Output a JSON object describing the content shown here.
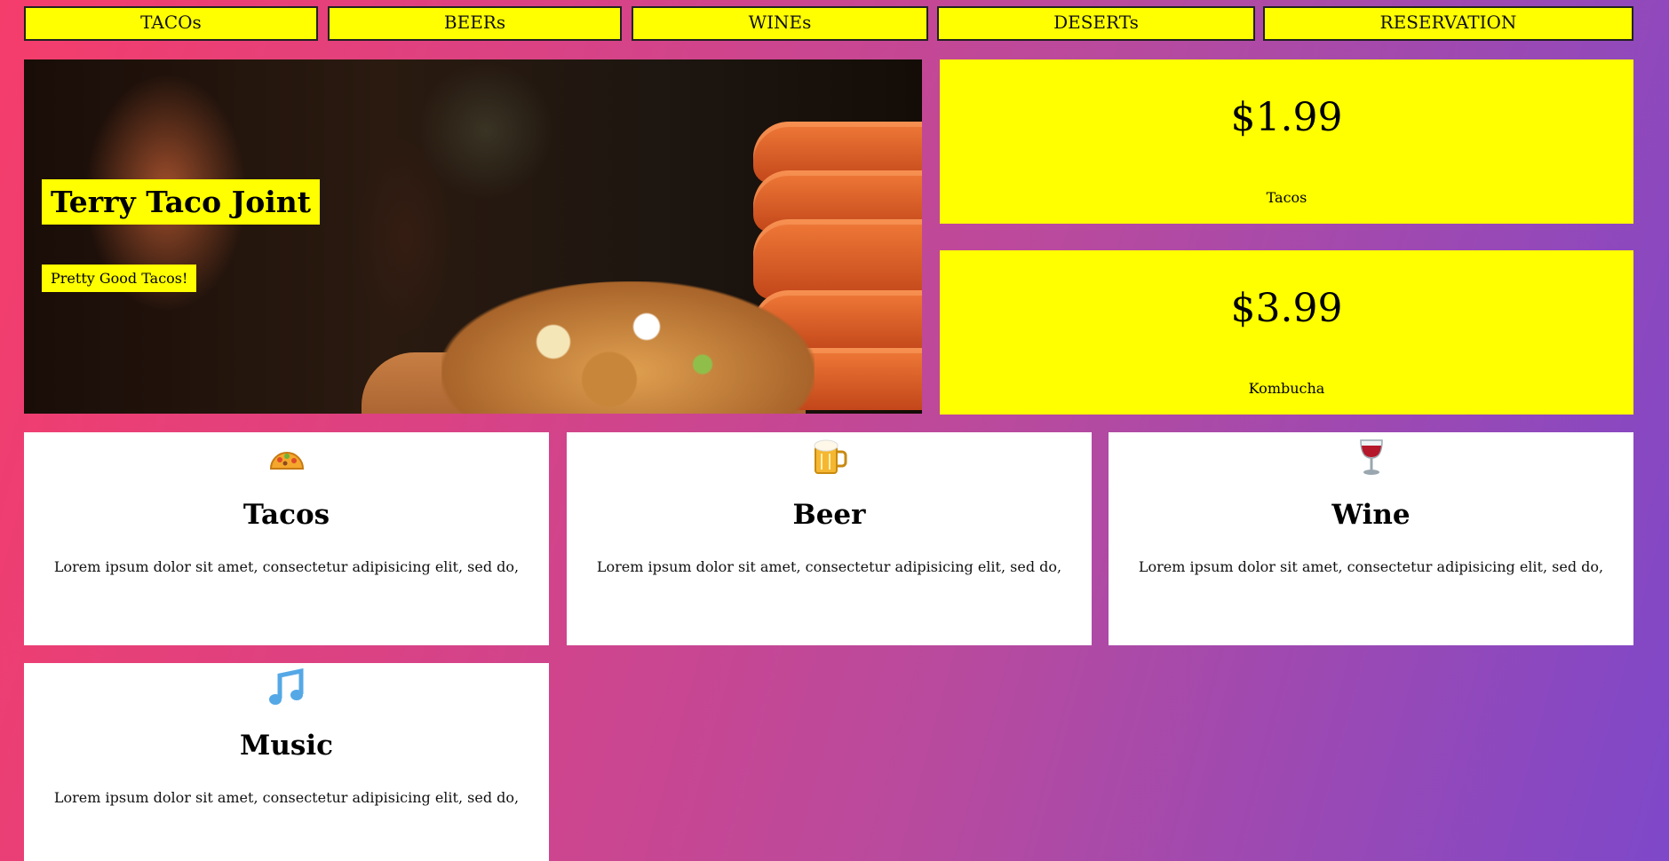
{
  "nav": {
    "items": [
      {
        "label": "TACOs"
      },
      {
        "label": "BEERs"
      },
      {
        "label": "WINEs"
      },
      {
        "label": "DESERTs"
      },
      {
        "label": "RESERVATION"
      }
    ]
  },
  "hero": {
    "title": "Terry Taco Joint",
    "subtitle": "Pretty Good Tacos!"
  },
  "prices": [
    {
      "amount": "$1.99",
      "label": "Tacos"
    },
    {
      "amount": "$3.99",
      "label": "Kombucha"
    }
  ],
  "features": [
    {
      "icon": "taco-icon",
      "title": "Tacos",
      "text": "Lorem ipsum dolor sit amet, consectetur adipisicing elit, sed do,"
    },
    {
      "icon": "beer-mug-icon",
      "title": "Beer",
      "text": "Lorem ipsum dolor sit amet, consectetur adipisicing elit, sed do,"
    },
    {
      "icon": "wine-glass-icon",
      "title": "Wine",
      "text": "Lorem ipsum dolor sit amet, consectetur adipisicing elit, sed do,"
    },
    {
      "icon": "music-note-icon",
      "title": "Music",
      "text": "Lorem ipsum dolor sit amet, consectetur adipisicing elit, sed do,"
    }
  ],
  "colors": {
    "accent": "#ffff00",
    "gradient_start": "#f53d6b",
    "gradient_end": "#7e48c9"
  }
}
